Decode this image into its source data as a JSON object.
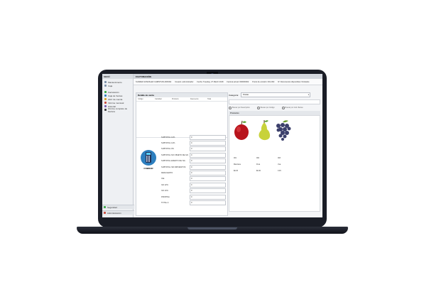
{
  "app": {
    "sidebar": {
      "header": "MENÚ",
      "items": [
        {
          "label": "Mantenimiento",
          "icon": "wrench-icon"
        },
        {
          "label": "Caja",
          "icon": "box-icon"
        },
        {
          "label": "Facturación",
          "icon": "invoice-icon"
        },
        {
          "label": "Caja de Ventas",
          "icon": "cash-icon"
        },
        {
          "label": "Abrir de cuenta",
          "icon": "folder-icon"
        },
        {
          "label": "Informe mensual",
          "icon": "report-icon"
        },
        {
          "label": "Historial",
          "icon": "history-icon"
        },
        {
          "label": "Informe completo de Factura",
          "icon": "document-icon"
        }
      ],
      "footer": [
        {
          "label": "Seguridad",
          "icon": "lock-icon"
        },
        {
          "label": "Administración",
          "icon": "user-icon"
        }
      ]
    },
    "title": "FACTURACIÓN",
    "infobar": {
      "user_name": "SUAREZ GONZALEZ CHRISTIAN ADRIAN",
      "user_role": "Usuario: administrador",
      "date": "Fecha: Tuesday, 27 March 2018",
      "invoice": "Factura actual: 000000002",
      "terminal": "Punto de emisión: 001-002",
      "docs": "Nº Documentos disponibles: Ilimitados"
    },
    "sale_detail": {
      "header": "Detalle de venta",
      "columns": [
        "Código",
        "Cantidad",
        "Producto",
        "Descuento",
        "Total"
      ]
    },
    "charge": {
      "label": "COBRAR",
      "icon": "calculator-icon"
    },
    "totals": [
      {
        "label": "SUBTOTAL 12%",
        "value": "0"
      },
      {
        "label": "SUBTOTAL 14%",
        "value": "0"
      },
      {
        "label": "SUBTOTAL 0%",
        "value": "0"
      },
      {
        "label": "SUBTOTAL NO OBJETO DE IVA",
        "value": "0"
      },
      {
        "label": "SUBTOTAL EXENTO DE IVA",
        "value": "0"
      },
      {
        "label": "SUBTOTAL SIN IMPUESTOS",
        "value": "0"
      },
      {
        "label": "DESCUENTO",
        "value": "0"
      },
      {
        "label": "ICE",
        "value": "0"
      },
      {
        "label": "IVA 12%",
        "value": "0"
      },
      {
        "label": "IVA 14%",
        "value": "0"
      },
      {
        "label": "PROPINA",
        "value": "0"
      },
      {
        "label": "TOTAL A",
        "value": "0"
      }
    ],
    "category": {
      "label": "Categoría:",
      "selected": "Frutas"
    },
    "filters": [
      "Buscar por Descripción",
      "Buscar por Código",
      "Buscar por Cód. Barras"
    ],
    "products_header": "Productos",
    "products": [
      {
        "code": "001",
        "name": "Manzana",
        "price": "$0.25",
        "image": "apple-icon"
      },
      {
        "code": "002",
        "name": "Pera",
        "price": "$0.30",
        "image": "pear-icon"
      },
      {
        "code": "003",
        "name": "Uva",
        "price": "0.45",
        "image": "grape-icon"
      }
    ]
  }
}
